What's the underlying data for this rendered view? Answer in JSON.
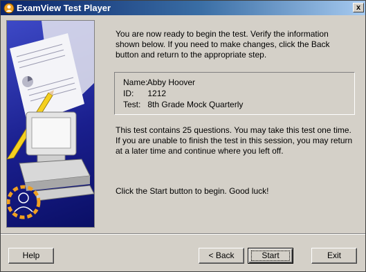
{
  "window": {
    "title": "ExamView Test Player",
    "close_label": "x"
  },
  "intro": {
    "text": "You are now ready to begin the test.  Verify the information shown below.  If you need to make changes, click the Back button and return to the appropriate step."
  },
  "info": {
    "name_label": "Name:",
    "name_value": "Abby Hoover",
    "id_label": "ID:",
    "id_value": "1212",
    "test_label": "Test:",
    "test_value": "8th Grade Mock Quarterly"
  },
  "details": {
    "text": "This test contains 25 questions.  You may take this test one time.  If you are unable to finish the test in this session, you may return at a later time and continue where you left off."
  },
  "final": {
    "text": "Click the Start button to begin.  Good luck!"
  },
  "buttons": {
    "help": "Help",
    "back": "< Back",
    "start": "Start",
    "exit": "Exit"
  },
  "icons": {
    "title_icon": "examview-app-icon",
    "illustration": "test-paper-computer-illustration"
  }
}
